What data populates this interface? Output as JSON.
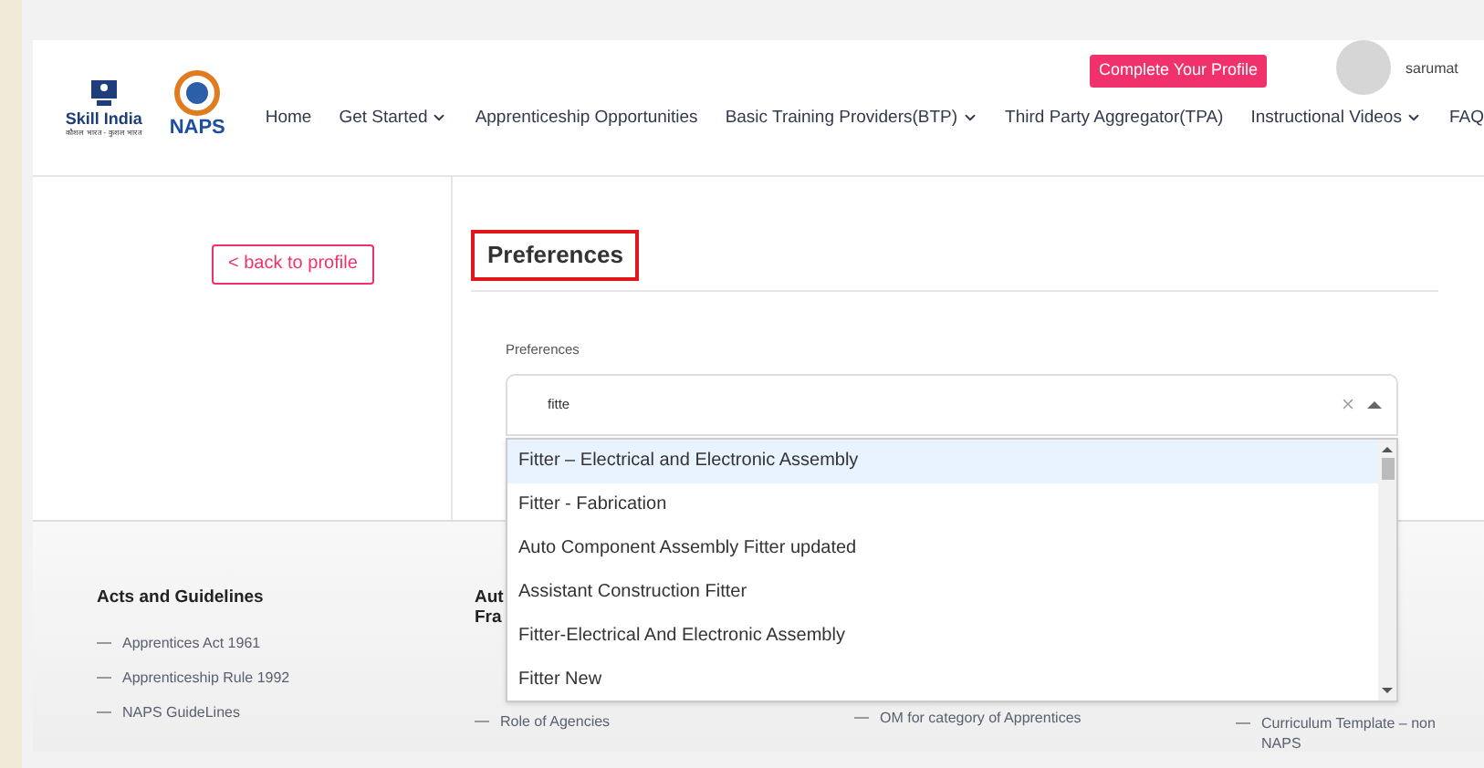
{
  "header": {
    "skill_logo": {
      "name": "Skill India",
      "tagline": "कौशल भारत - कुशल भारत"
    },
    "naps_logo": {
      "name": "NAPS"
    },
    "profile_button": "Complete Your Profile",
    "username": "sarumat",
    "nav": [
      {
        "label": "Home",
        "dropdown": false
      },
      {
        "label": "Get Started",
        "dropdown": true
      },
      {
        "label": "Apprenticeship Opportunities",
        "dropdown": false
      },
      {
        "label": "Basic Training Providers(BTP)",
        "dropdown": true
      },
      {
        "label": "Third Party Aggregator(TPA)",
        "dropdown": false
      },
      {
        "label": "Instructional Videos",
        "dropdown": true
      },
      {
        "label": "FAQ",
        "dropdown": false
      }
    ]
  },
  "back_button": "< back to profile",
  "section_title": "Preferences",
  "field": {
    "label": "Preferences",
    "value": "fitte",
    "open": true
  },
  "options": [
    {
      "label": "Fitter – Electrical and Electronic Assembly",
      "selected": true
    },
    {
      "label": "Fitter - Fabrication",
      "selected": false
    },
    {
      "label": "Auto Component Assembly Fitter updated",
      "selected": false
    },
    {
      "label": "Assistant Construction Fitter",
      "selected": false
    },
    {
      "label": "Fitter-Electrical And Electronic Assembly",
      "selected": false
    },
    {
      "label": "Fitter New",
      "selected": false
    }
  ],
  "footer": {
    "columns": [
      {
        "heading": [
          "Acts and Guidelines"
        ],
        "links": [
          "Apprentices Act 1961",
          "Apprenticeship Rule 1992",
          "NAPS GuideLines"
        ]
      },
      {
        "heading": [
          "Aut",
          "Fra"
        ],
        "links": [
          "Role of Agencies"
        ]
      },
      {
        "links": [
          "OM for category of Apprentices"
        ]
      },
      {
        "links": [
          "Curriculum Template – non NAPS"
        ]
      }
    ]
  }
}
